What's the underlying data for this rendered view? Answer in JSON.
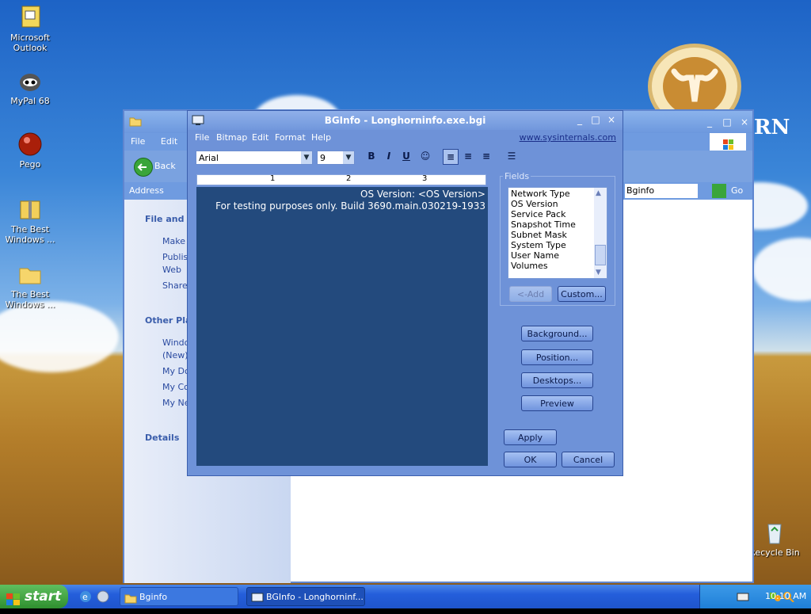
{
  "desktop": {
    "icons": [
      {
        "label": "Microsoft Outlook"
      },
      {
        "label": "MyPal 68"
      },
      {
        "label": "Pego"
      },
      {
        "label": "The Best Windows ..."
      },
      {
        "label": "The Best Windows ..."
      },
      {
        "label": "Recycle Bin"
      }
    ],
    "wallpaper_text": "RN"
  },
  "explorer": {
    "menu": [
      "File",
      "Edit"
    ],
    "back_label": "Back",
    "address_label": "Address",
    "address_value": "Bginfo",
    "go_label": "Go",
    "tasks": {
      "file_folder_heading": "File and Fo",
      "items": [
        "Make a",
        "Publish",
        "Web",
        "Share"
      ],
      "other_places_heading": "Other Plac",
      "places": [
        "Windo",
        "(New)",
        "My Do",
        "My Co",
        "My Ne"
      ],
      "details_heading": "Details"
    }
  },
  "dialog": {
    "title": "BGInfo - Longhorninfo.exe.bgi",
    "menu": [
      "File",
      "Bitmap",
      "Edit",
      "Format",
      "Help"
    ],
    "link": "www.sysinternals.com",
    "font_name": "Arial",
    "font_size": "9",
    "ruler_marks": [
      "1",
      "2",
      "3"
    ],
    "editor_lines": [
      "OS Version:  <OS Version>",
      "For testing purposes only. Build 3690.main.030219-1933"
    ],
    "fields_label": "Fields",
    "fields": [
      "Network Type",
      "OS Version",
      "Service Pack",
      "Snapshot Time",
      "Subnet Mask",
      "System Type",
      "User Name",
      "Volumes"
    ],
    "add_label": "<-Add",
    "custom_label": "Custom...",
    "background_label": "Background...",
    "position_label": "Position...",
    "desktops_label": "Desktops...",
    "preview_label": "Preview",
    "apply_label": "Apply",
    "ok_label": "OK",
    "cancel_label": "Cancel"
  },
  "taskbar": {
    "start_label": "start",
    "tasks": [
      "Bginfo",
      "BGInfo - Longhorninf..."
    ],
    "clock": "10:10 AM"
  }
}
